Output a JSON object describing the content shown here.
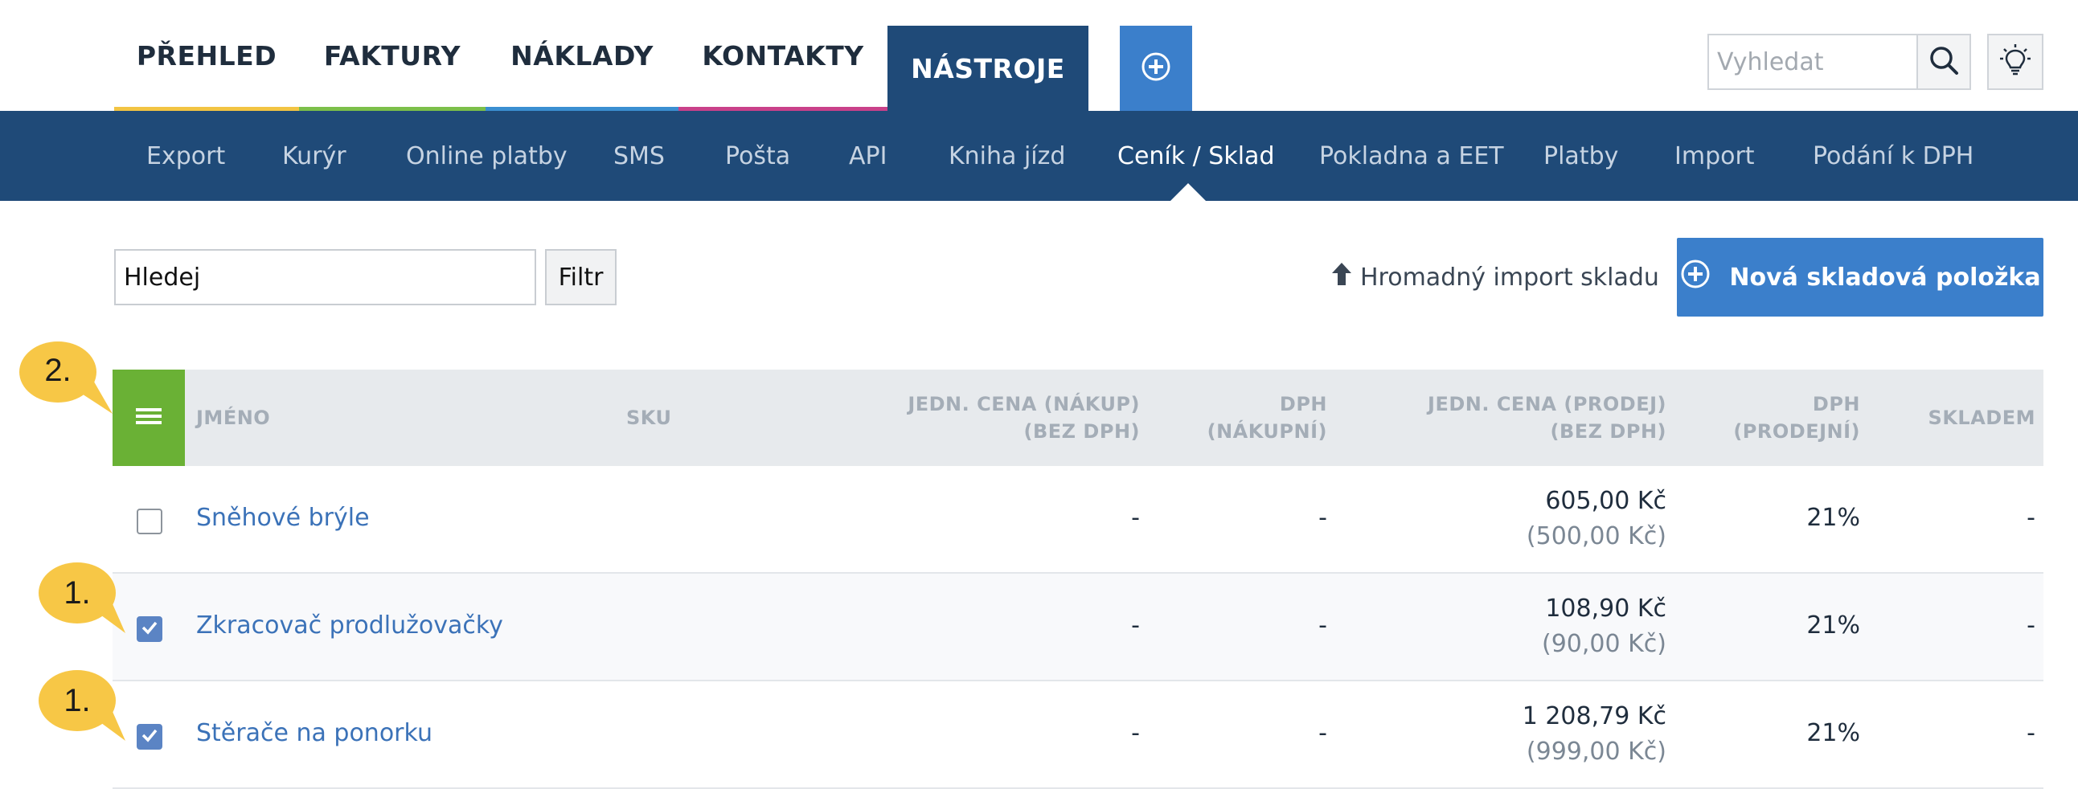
{
  "topnav": {
    "tabs": [
      {
        "label": "PŘEHLED",
        "color": "#f2c443"
      },
      {
        "label": "FAKTURY",
        "color": "#7cbf4a"
      },
      {
        "label": "NÁKLADY",
        "color": "#3b8fd1"
      },
      {
        "label": "KONTAKTY",
        "color": "#c9418a"
      },
      {
        "label": "NÁSTROJE",
        "color": "#1f4a78",
        "active": true
      }
    ],
    "search_placeholder": "Vyhledat"
  },
  "subnav": {
    "items": [
      {
        "label": "Export"
      },
      {
        "label": "Kurýr"
      },
      {
        "label": "Online platby"
      },
      {
        "label": "SMS"
      },
      {
        "label": "Pošta"
      },
      {
        "label": "API"
      },
      {
        "label": "Kniha jízd"
      },
      {
        "label": "Ceník / Sklad",
        "active": true
      },
      {
        "label": "Pokladna a EET"
      },
      {
        "label": "Platby"
      },
      {
        "label": "Import"
      },
      {
        "label": "Podání k DPH"
      }
    ]
  },
  "toolbar": {
    "filter_value": "Hledej",
    "filter_button": "Filtr",
    "import_label": "Hromadný import skladu",
    "new_button": "Nová skladová položka"
  },
  "table": {
    "headers": {
      "name": "JMÉNO",
      "sku": "SKU",
      "buy_price_1": "JEDN. CENA (NÁKUP)",
      "buy_price_2": "(BEZ DPH)",
      "buy_vat_1": "DPH",
      "buy_vat_2": "(NÁKUPNÍ)",
      "sell_price_1": "JEDN. CENA (PRODEJ)",
      "sell_price_2": "(BEZ DPH)",
      "sell_vat_1": "DPH",
      "sell_vat_2": "(PRODEJNÍ)",
      "stock": "SKLADEM"
    },
    "rows": [
      {
        "checked": false,
        "name": "Sněhové brýle",
        "buy_price": "-",
        "buy_vat": "-",
        "sell_price": "605,00 Kč",
        "sell_price_net": "(500,00 Kč)",
        "sell_vat": "21%",
        "stock": "-"
      },
      {
        "checked": true,
        "name": "Zkracovač prodlužovačky",
        "buy_price": "-",
        "buy_vat": "-",
        "sell_price": "108,90 Kč",
        "sell_price_net": "(90,00 Kč)",
        "sell_vat": "21%",
        "stock": "-"
      },
      {
        "checked": true,
        "name": "Stěrače na ponorku",
        "buy_price": "-",
        "buy_vat": "-",
        "sell_price": "1 208,79 Kč",
        "sell_price_net": "(999,00 Kč)",
        "sell_vat": "21%",
        "stock": "-"
      }
    ]
  },
  "callouts": [
    {
      "label": "2.",
      "color": "#f7c746"
    },
    {
      "label": "1.",
      "color": "#f7c746"
    },
    {
      "label": "1.",
      "color": "#f7c746"
    }
  ],
  "icons": {
    "plus": "plus-circle-icon",
    "search": "search-icon",
    "bulb": "lightbulb-icon",
    "upload": "upload-arrow-icon",
    "menu": "hamburger-menu-icon",
    "check": "checkmark-icon"
  }
}
